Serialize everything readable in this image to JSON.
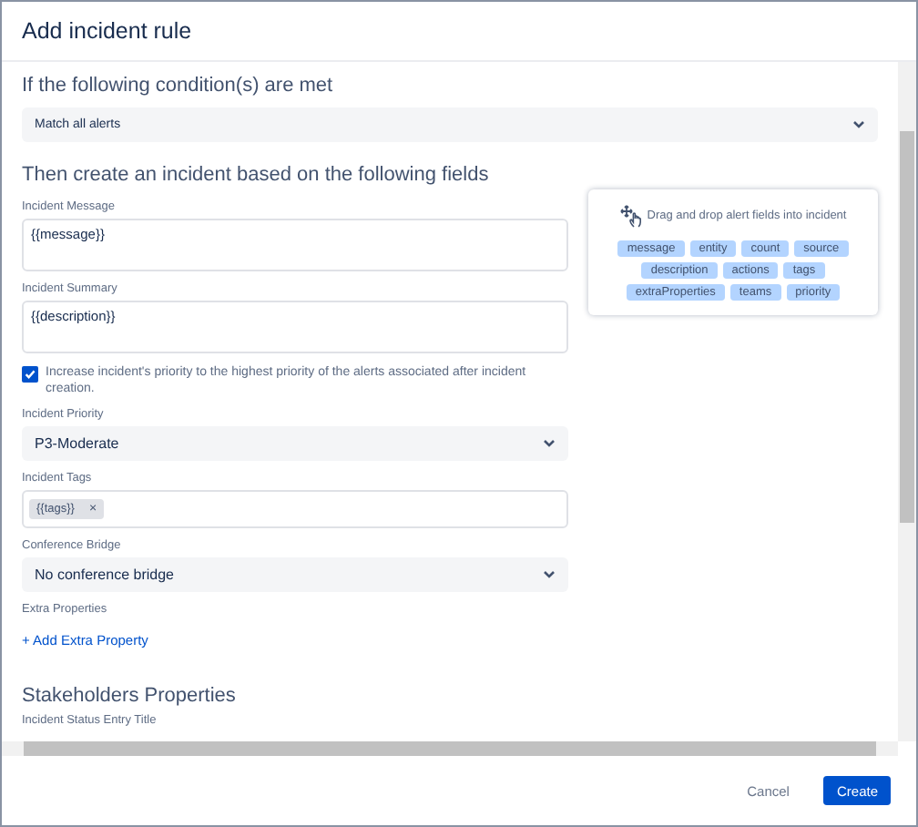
{
  "dialog": {
    "title": "Add incident rule"
  },
  "condition_section": {
    "heading": "If the following condition(s) are met",
    "select": {
      "value": "Match all alerts"
    }
  },
  "fields_section": {
    "heading": "Then create an incident based on the following fields",
    "fields": [
      {
        "kind": "textarea",
        "label": "Incident Message",
        "value": "{{message}}"
      },
      {
        "kind": "textarea",
        "label": "Incident Summary",
        "value": "{{description}}"
      },
      {
        "kind": "checkbox",
        "label": "Increase incident's priority to the highest priority of the alerts associated after incident creation.",
        "checked": true
      },
      {
        "kind": "select",
        "label": "Incident Priority",
        "value": "P3-Moderate"
      },
      {
        "kind": "tags",
        "label": "Incident Tags",
        "tags": [
          {
            "text": "{{tags}}",
            "remove": "×"
          }
        ]
      },
      {
        "kind": "select",
        "label": "Conference Bridge",
        "value": "No conference bridge"
      },
      {
        "kind": "link",
        "label": "Extra Properties",
        "link": "+ Add Extra Property"
      }
    ]
  },
  "drag_panel": {
    "hint": "Drag and drop alert fields into incident",
    "chip_rows": [
      [
        "message",
        "entity",
        "count",
        "source"
      ],
      [
        "description",
        "actions",
        "tags"
      ],
      [
        "extraProperties",
        "teams",
        "priority"
      ]
    ]
  },
  "stakeholders_section": {
    "heading": "Stakeholders Properties",
    "fields": [
      {
        "label": "Incident Status Entry Title"
      }
    ]
  },
  "footer": {
    "buttons": [
      {
        "label": "Cancel",
        "kind": "secondary"
      },
      {
        "label": "Create",
        "kind": "primary"
      }
    ]
  }
}
